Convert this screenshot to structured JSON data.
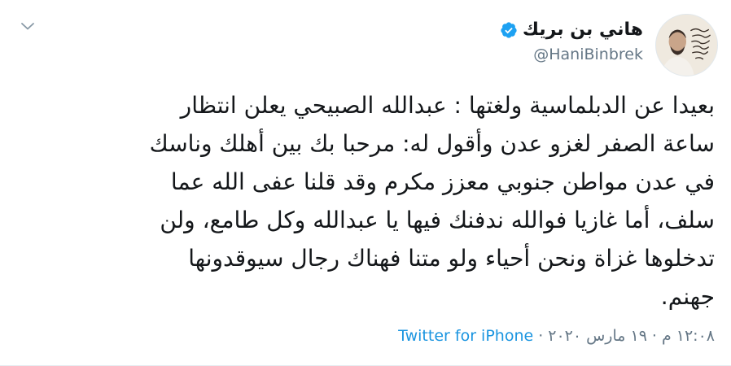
{
  "author": {
    "display_name": "هاني بن بريك",
    "handle": "@HaniBinbrek",
    "verified": true
  },
  "tweet": {
    "lines": [
      "بعيدا عن الدبلماسية ولغتها : عبدالله الصبيحي يعلن انتظار",
      "ساعة الصفر لغزو عدن وأقول له: مرحبا بك بين أهلك وناسك",
      "في عدن مواطن جنوبي معزز مكرم وقد قلنا عفى الله عما",
      "سلف، أما غازيا فوالله ندفنك فيها يا عبدالله وكل طامع، ولن",
      "تدخلوها غزاة ونحن أحياء ولو متنا فهناك رجال سيوقدونها",
      "جهنم."
    ]
  },
  "meta": {
    "time": "١٢:٠٨ م",
    "separator": "·",
    "date": "١٩ مارس ٢٠٢٠",
    "source": "Twitter for iPhone"
  },
  "icons": {
    "verified": "verified-badge-icon",
    "caret": "chevron-down-icon"
  },
  "colors": {
    "accent": "#1da1f2",
    "source_link": "#1b95e0",
    "secondary_text": "#657786",
    "primary_text": "#14171a"
  }
}
